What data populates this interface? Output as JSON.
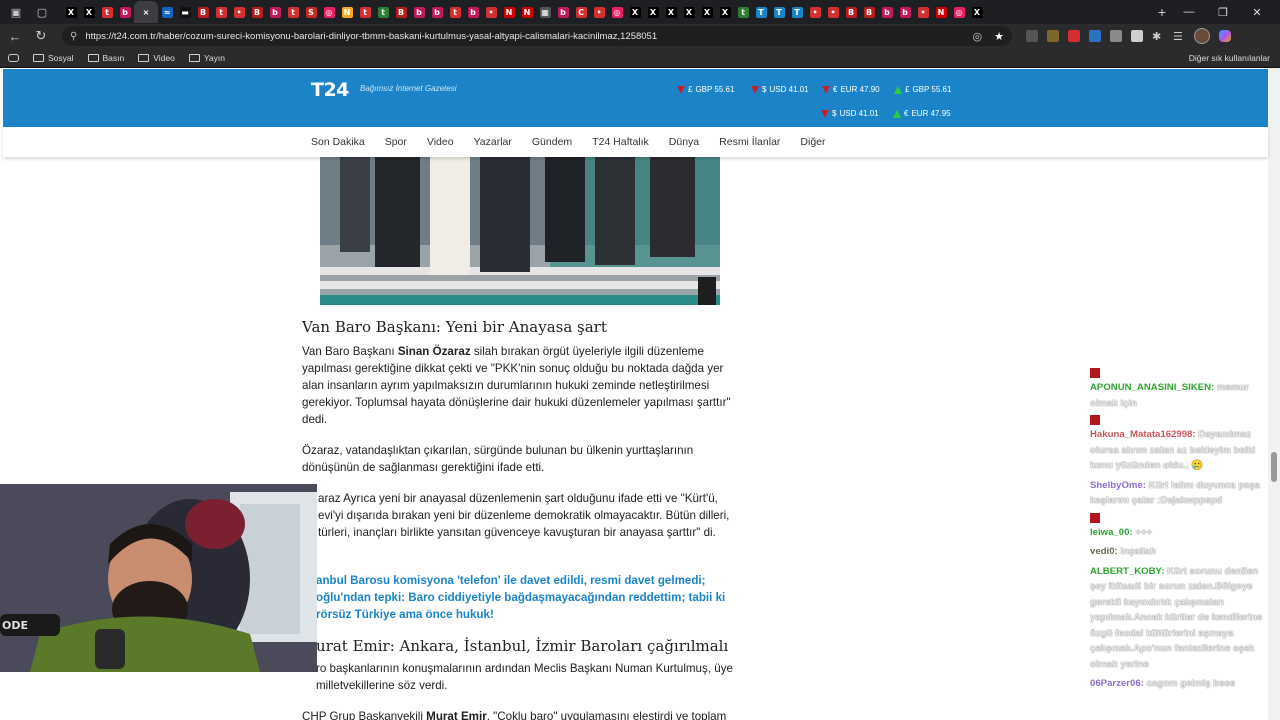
{
  "browser": {
    "url": "https://t24.com.tr/haber/cozum-sureci-komisyonu-barolari-dinliyor-tbmm-baskani-kurtulmus-yasal-altyapi-calismalari-kacinilmaz,1258051",
    "tabs": [
      {
        "letter": "X",
        "color": "#000000"
      },
      {
        "letter": "X",
        "color": "#000000"
      },
      {
        "letter": "t",
        "color": "#d32f2f"
      },
      {
        "letter": "b",
        "color": "#c2185b"
      },
      {
        "letter": "×",
        "color": "#3c3d41"
      },
      {
        "letter": "≈",
        "color": "#1565c0"
      },
      {
        "letter": "▬",
        "color": "#111111"
      },
      {
        "letter": "B",
        "color": "#b71c1c"
      },
      {
        "letter": "t",
        "color": "#d32f2f"
      },
      {
        "letter": "•",
        "color": "#d32f2f"
      },
      {
        "letter": "B",
        "color": "#b71c1c"
      },
      {
        "letter": "b",
        "color": "#c2185b"
      },
      {
        "letter": "t",
        "color": "#d32f2f"
      },
      {
        "letter": "S",
        "color": "#c62828"
      },
      {
        "letter": "◎",
        "color": "#e91e63"
      },
      {
        "letter": "N",
        "color": "#f9a825"
      },
      {
        "letter": "t",
        "color": "#d32f2f"
      },
      {
        "letter": "t",
        "color": "#2e7d32"
      },
      {
        "letter": "B",
        "color": "#b71c1c"
      },
      {
        "letter": "b",
        "color": "#c2185b"
      },
      {
        "letter": "b",
        "color": "#c2185b"
      },
      {
        "letter": "t",
        "color": "#d32f2f"
      },
      {
        "letter": "b",
        "color": "#c2185b"
      },
      {
        "letter": "•",
        "color": "#d32f2f"
      },
      {
        "letter": "N",
        "color": "#d50000"
      },
      {
        "letter": "N",
        "color": "#d50000"
      },
      {
        "letter": "▦",
        "color": "#555555"
      },
      {
        "letter": "b",
        "color": "#c2185b"
      },
      {
        "letter": "C",
        "color": "#d32f2f"
      },
      {
        "letter": "•",
        "color": "#d32f2f"
      },
      {
        "letter": "◎",
        "color": "#e91e63"
      },
      {
        "letter": "X",
        "color": "#000000"
      },
      {
        "letter": "X",
        "color": "#000000"
      },
      {
        "letter": "X",
        "color": "#000000"
      },
      {
        "letter": "X",
        "color": "#000000"
      },
      {
        "letter": "X",
        "color": "#000000"
      },
      {
        "letter": "X",
        "color": "#000000"
      },
      {
        "letter": "t",
        "color": "#2e7d32"
      },
      {
        "letter": "T",
        "color": "#1b84c8"
      },
      {
        "letter": "T",
        "color": "#1b84c8"
      },
      {
        "letter": "T",
        "color": "#1b84c8"
      },
      {
        "letter": "•",
        "color": "#d32f2f"
      },
      {
        "letter": "•",
        "color": "#d32f2f"
      },
      {
        "letter": "B",
        "color": "#b71c1c"
      },
      {
        "letter": "B",
        "color": "#b71c1c"
      },
      {
        "letter": "b",
        "color": "#c2185b"
      },
      {
        "letter": "b",
        "color": "#c2185b"
      },
      {
        "letter": "•",
        "color": "#d32f2f"
      },
      {
        "letter": "N",
        "color": "#d50000"
      },
      {
        "letter": "◎",
        "color": "#e91e63"
      },
      {
        "letter": "X",
        "color": "#000000"
      }
    ],
    "bookmarks": [
      "Sosyal",
      "Basın",
      "Video",
      "Yayın"
    ],
    "bookmarks_right": "Diğer sık kullanılanlar"
  },
  "site": {
    "logo": "T24",
    "tagline": "Bağımsız İnternet Gazetesi",
    "currencies_row1": [
      {
        "dir": "down",
        "symbol": "£",
        "label": "GBP 55.61"
      },
      {
        "dir": "down",
        "symbol": "$",
        "label": "USD 41.01"
      },
      {
        "dir": "down",
        "symbol": "€",
        "label": "EUR 47.90"
      },
      {
        "dir": "up",
        "symbol": "£",
        "label": "GBP 55.61"
      }
    ],
    "currencies_row2": [
      {
        "dir": "down",
        "symbol": "$",
        "label": "USD 41.01"
      },
      {
        "dir": "up",
        "symbol": "€",
        "label": "EUR 47.95"
      }
    ],
    "nav": [
      "Son Dakika",
      "Spor",
      "Video",
      "Yazarlar",
      "Gündem",
      "T24 Haftalık",
      "Dünya",
      "Resmi İlanlar",
      "Diğer"
    ]
  },
  "article": {
    "h_van": "Van Baro Başkanı: Yeni bir Anayasa şart",
    "p1_pre": "Van Baro Başkanı ",
    "p1_name": "Sinan Özaraz",
    "p1_post": " silah bırakan örgüt üyeleriyle ilgili düzenleme yapılması gerektiğine dikkat çekti ve \"PKK'nin sonuç olduğu bu noktada dağda yer alan insanların ayrım yapılmaksızın durumlarının hukuki zeminde netleştirilmesi gerekiyor. Toplumsal hayata dönüşlerine dair hukuki düzenlemeler yapılması şarttır\" dedi.",
    "p2": "Özaraz, vatandaşlıktan çıkarılan, sürgünde bulunan bu ülkenin yurttaşlarının dönüşünün de sağlanması gerektiğini ifade etti.",
    "p3": "araz Ayrıca yeni bir anayasal düzenlemenin şart olduğunu ifade etti ve \"Kürt'ü, evi'yi dışarıda bırakan yeni bir düzenleme demokratik olmayacaktır. Bütün dilleri, türleri, inançları birlikte yansıtan güvenceye kavuşturan bir anayasa şarttır\" di.",
    "link1": "anbul Barosu komisyona 'telefon' ile davet edildi, resmi davet gelmedi;",
    "link2": "oğlu'ndan tepki: Baro ciddiyetiyle bağdaşmayacağından reddettim; tabii ki rörsüz Türkiye ama önce hukuk!",
    "h_emir": "urat Emir: Ankara, İstanbul, İzmir Baroları çağırılmalı",
    "p4": "ro başkanlarının konuşmalarının ardından Meclis Başkanı Numan Kurtulmuş, üye milletvekillerine söz verdi.",
    "p5_pre": "CHP Grup Başkanvekili ",
    "p5_name": "Murat Emir",
    "p5_post": ", \"Çoklu baro\" uygulamasını eleştirdi ve toplam"
  },
  "chat": [
    {
      "badge": true,
      "user": "APONUN_ANASINI_SIKEN:",
      "cls": "u1",
      "text": " memur olmak için"
    },
    {
      "badge": true,
      "user": "Hakuna_Matata162998:",
      "cls": "u2",
      "text": " Dayanılmaz olursa alırım zaten az bekleyim belki konu yüzünden oldu.. 🥲"
    },
    {
      "badge": false,
      "user": "ShelbyOme:",
      "cls": "u3",
      "text": " Kürt lafını duyunca paşa kaşlarını çatar :Dsjakwppepd"
    },
    {
      "badge": true,
      "user": "leiwa_00:",
      "cls": "u1",
      "text": " +++"
    },
    {
      "badge": false,
      "user": "vedi0:",
      "cls": "u4",
      "text": " inşallah"
    },
    {
      "badge": false,
      "user": "ALBERT_KOBY:",
      "cls": "u1",
      "text": " Kürt sorunu denilen şey ikiisadi bir sorun zaten.Bölgeye gerekli bayındırlık çalışmaları yapılmalı.Ancak kürtler de kendilerine özgü feodal kültürlerini aşmaya çalışmalı.Apo'nun fantezilerine eşek olmak yerine"
    },
    {
      "badge": false,
      "user": "06Parzer06:",
      "cls": "u3",
      "text": " cagom gelmiş beee"
    }
  ],
  "webcam": {
    "mic_text": "ODE"
  }
}
